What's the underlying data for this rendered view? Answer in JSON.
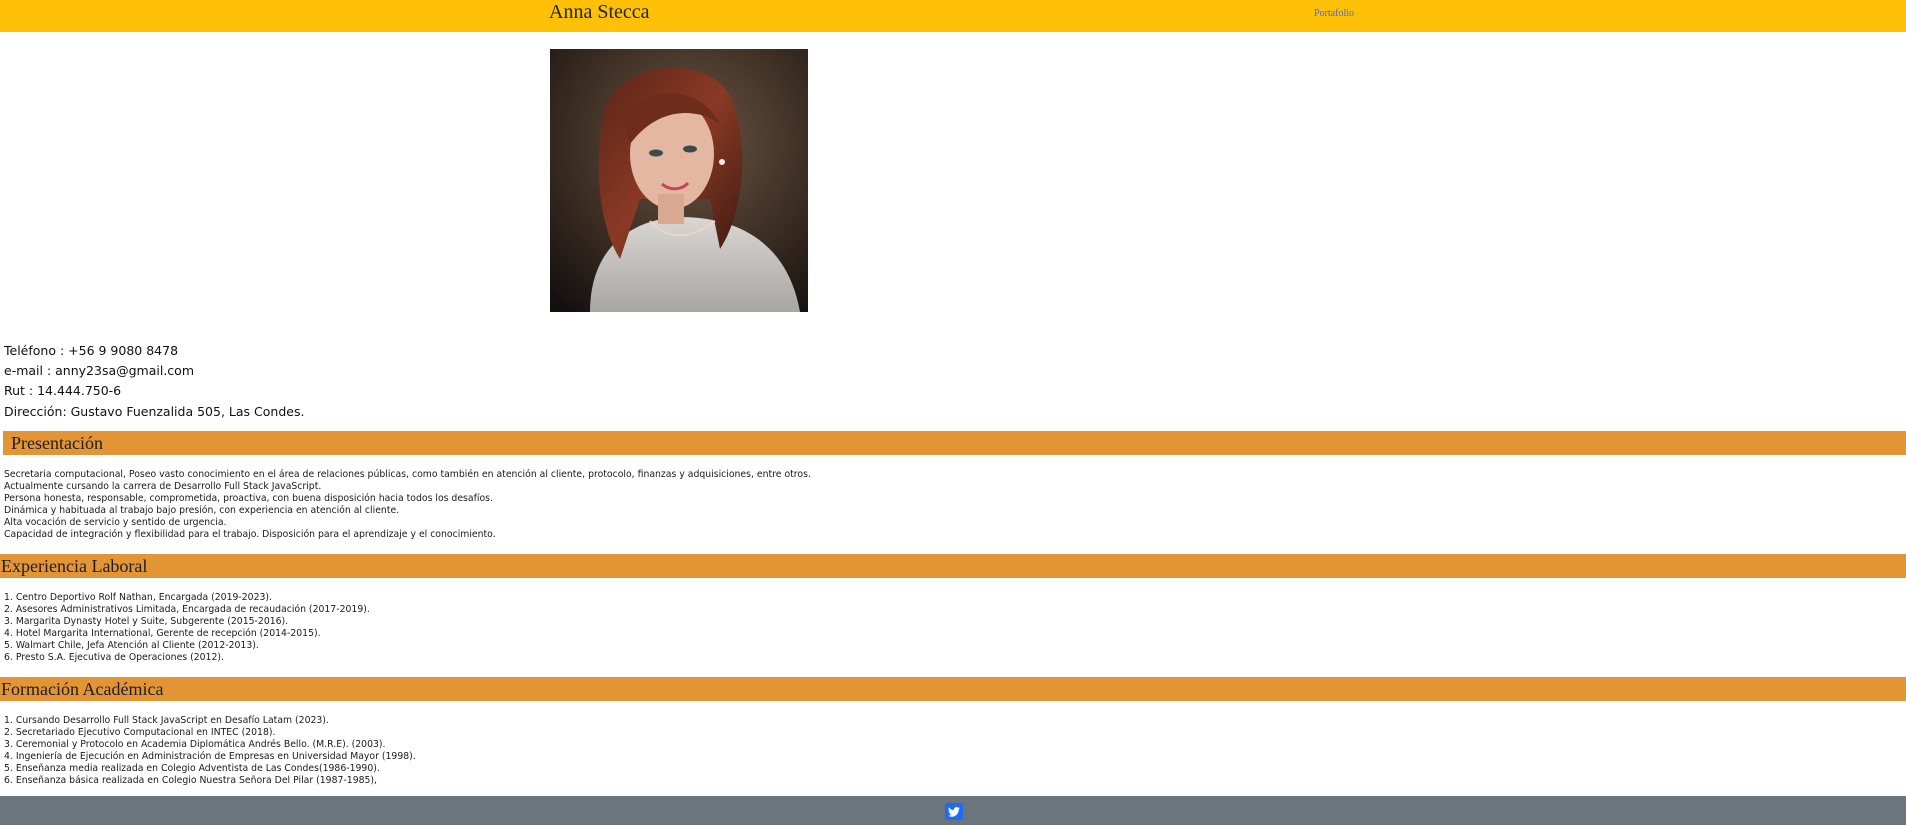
{
  "nav": {
    "brand": "Anna Stecca",
    "link": "Portafolio"
  },
  "photo": {
    "alt_icon": "profile-photo"
  },
  "contact": [
    "Teléfono : +56 9 9080 8478",
    "e-mail : anny23sa@gmail.com",
    "Rut : 14.444.750-6",
    "Dirección: Gustavo Fuenzalida 505, Las Condes."
  ],
  "sections": [
    {
      "title": "Presentación",
      "lines": [
        "Secretaria computacional, Poseo vasto conocimiento en el área de relaciones públicas, como también en atención al cliente, protocolo, finanzas y adquisiciones, entre otros.",
        "Actualmente cursando la carrera de Desarrollo Full Stack JavaScript.",
        "Persona honesta, responsable, comprometida, proactiva, con buena disposición hacia todos los desafíos.",
        "Dinámica y habituada al trabajo bajo presión, con experiencia en atención al cliente.",
        "Alta vocación de servicio y sentido de urgencia.",
        "Capacidad de integración y flexibilidad para el trabajo. Disposición para el aprendizaje y el conocimiento."
      ]
    },
    {
      "title": "Experiencia Laboral",
      "lines": [
        "1. Centro Deportivo Rolf Nathan, Encargada (2019-2023).",
        "2. Asesores Administrativos Limitada, Encargada de recaudación (2017-2019).",
        "3. Margarita Dynasty Hotel y Suite, Subgerente (2015-2016).",
        "4. Hotel Margarita International, Gerente de recepción (2014-2015).",
        "5. Walmart Chile, Jefa Atención al Cliente (2012-2013).",
        "6. Presto S.A. Ejecutiva de Operaciones (2012)."
      ]
    },
    {
      "title": "Formación Académica",
      "lines": [
        "1. Cursando Desarrollo Full Stack JavaScript en Desafío Latam (2023).",
        "2. Secretariado Ejecutivo Computacional en INTEC (2018).",
        "3. Ceremonial y Protocolo en Academia Diplomática Andrés Bello. (M.R.E). (2003).",
        "4. Ingeniería de Ejecución en Administración de Empresas en Universidad Mayor (1998).",
        "5. Enseñanza media realizada en Colegio Adventista de Las Condes(1986-1990).",
        "6. Enseñanza básica realizada en Colegio Nuestra Señora Del Pilar (1987-1985),"
      ]
    }
  ],
  "footer": {
    "icon": "twitter-icon"
  },
  "colors": {
    "navbar": "#ffc107",
    "section_band": "#e39536",
    "footer": "#6c757d",
    "twitter": "#1d6df2"
  }
}
